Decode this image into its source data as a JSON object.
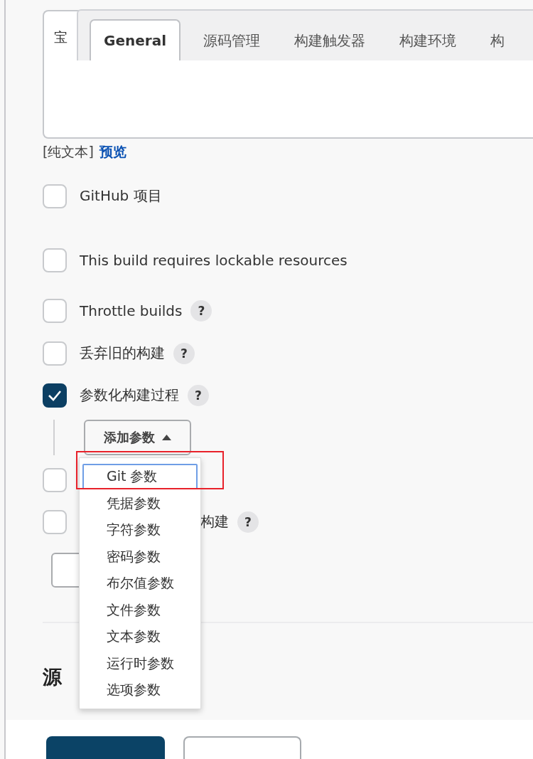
{
  "editor": {
    "text": "宝",
    "format_label": "[纯文本]",
    "preview_link": "预览"
  },
  "tabs": [
    {
      "label": "General",
      "selected": true
    },
    {
      "label": "源码管理",
      "selected": false
    },
    {
      "label": "构建触发器",
      "selected": false
    },
    {
      "label": "构建环境",
      "selected": false
    },
    {
      "label": "构",
      "selected": false
    }
  ],
  "options": [
    {
      "label": "GitHub 项目",
      "checked": false
    },
    {
      "label": "This build requires lockable resources",
      "checked": false
    },
    {
      "label": "Throttle builds",
      "checked": false,
      "help": "?"
    },
    {
      "label": "丢弃旧的构建",
      "checked": false,
      "help": "?"
    },
    {
      "label": "参数化构建过程",
      "checked": true,
      "help": "?"
    }
  ],
  "add_parameter": {
    "label": "添加参数",
    "expanded": true
  },
  "menu": [
    {
      "label": "Git 参数",
      "selected": true
    },
    {
      "label": "凭据参数",
      "selected": false
    },
    {
      "label": "字符参数",
      "selected": false
    },
    {
      "label": "密码参数",
      "selected": false
    },
    {
      "label": "布尔值参数",
      "selected": false
    },
    {
      "label": "文件参数",
      "selected": false
    },
    {
      "label": "文本参数",
      "selected": false
    },
    {
      "label": "运行时参数",
      "selected": false
    },
    {
      "label": "选项参数",
      "selected": false
    }
  ],
  "more_options": [
    {
      "kind": "covered",
      "checked": false
    },
    {
      "kind": "partly_covered",
      "label": "构建",
      "checked": false,
      "help": "?"
    }
  ],
  "section_heading": "源"
}
